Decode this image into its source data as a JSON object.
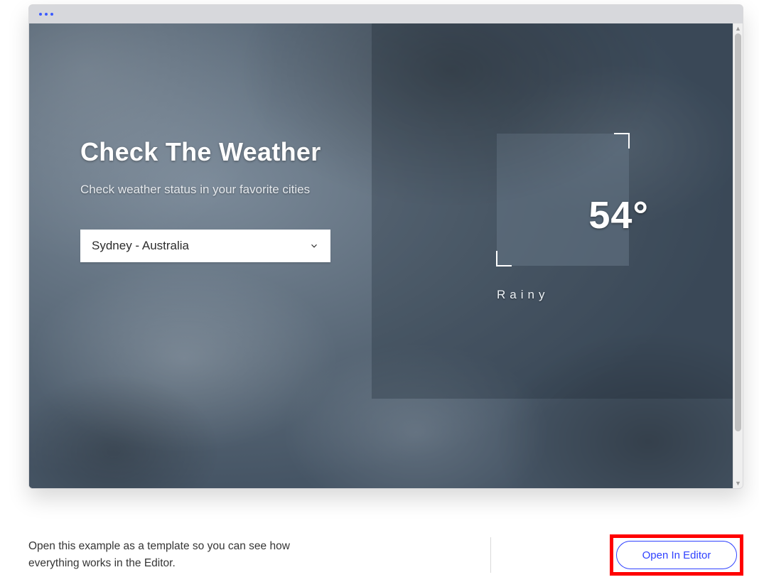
{
  "header": {
    "dots": 3
  },
  "hero": {
    "title": "Check The Weather",
    "subtitle": "Check weather status in your favorite cities"
  },
  "select": {
    "value": "Sydney - Australia"
  },
  "weather": {
    "temperature_display": "54°",
    "condition": "Rainy"
  },
  "footer": {
    "text": "Open this example as a template so you can see how everything works in the Editor.",
    "cta_label": "Open In Editor"
  }
}
